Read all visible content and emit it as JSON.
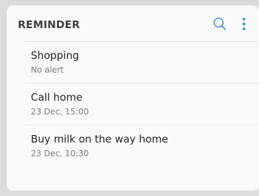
{
  "header": {
    "title": "REMINDER",
    "search_icon": "search-icon",
    "more_icon": "more-vert-icon"
  },
  "colors": {
    "accent": "#3a8fd1",
    "card_background": "#fafafa",
    "page_background": "#dcdcdc"
  },
  "reminders": [
    {
      "title": "Shopping",
      "subtitle": "No alert"
    },
    {
      "title": "Call home",
      "subtitle": "23 Dec, 15:00"
    },
    {
      "title": "Buy milk on the way home",
      "subtitle": "23 Dec, 10:30"
    }
  ]
}
